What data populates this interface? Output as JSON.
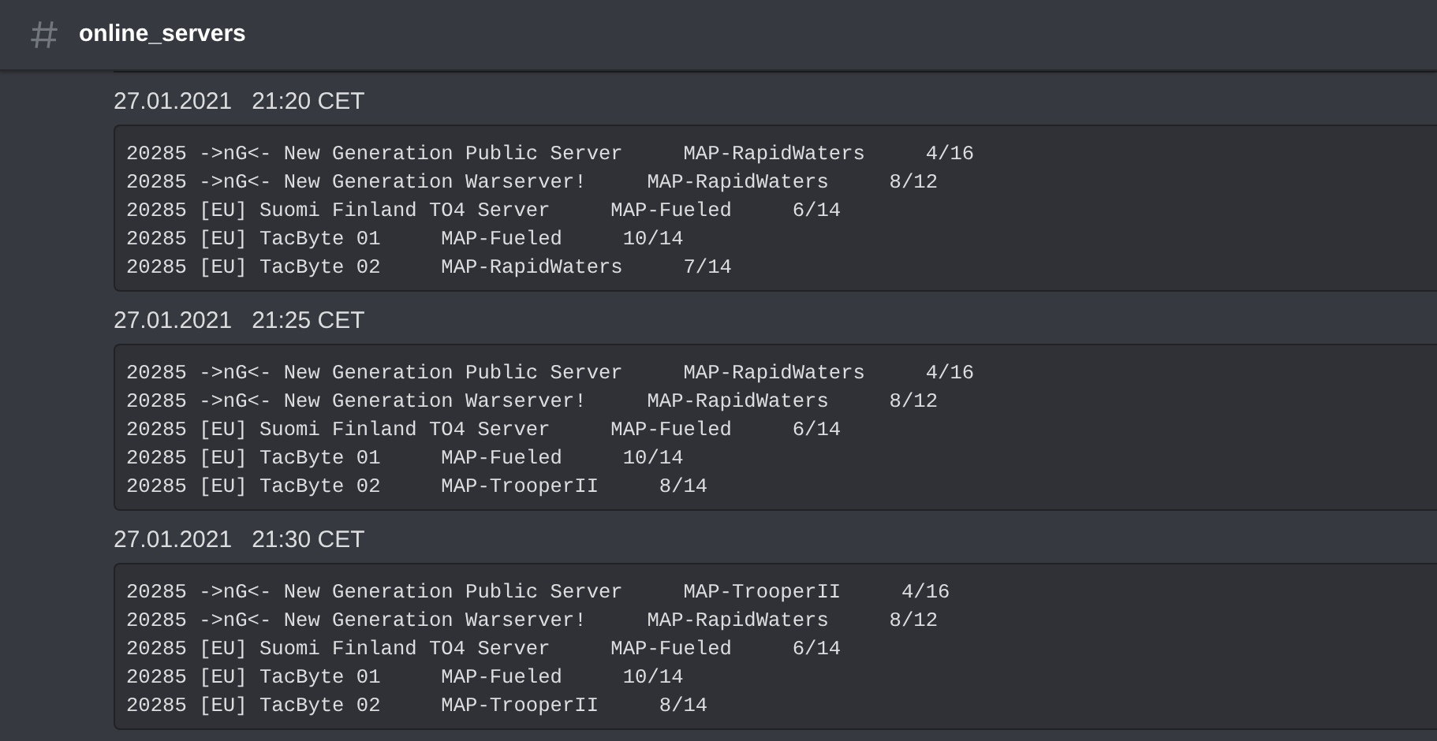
{
  "channel": {
    "name": "online_servers"
  },
  "messages": [
    {
      "timestamp": "27.01.2021   21:20 CET",
      "lines": [
        "20285 ->nG<- New Generation Public Server     MAP-RapidWaters     4/16",
        "20285 ->nG<- New Generation Warserver!     MAP-RapidWaters     8/12",
        "20285 [EU] Suomi Finland TO4 Server     MAP-Fueled     6/14",
        "20285 [EU] TacByte 01     MAP-Fueled     10/14",
        "20285 [EU] TacByte 02     MAP-RapidWaters     7/14"
      ]
    },
    {
      "timestamp": "27.01.2021   21:25 CET",
      "lines": [
        "20285 ->nG<- New Generation Public Server     MAP-RapidWaters     4/16",
        "20285 ->nG<- New Generation Warserver!     MAP-RapidWaters     8/12",
        "20285 [EU] Suomi Finland TO4 Server     MAP-Fueled     6/14",
        "20285 [EU] TacByte 01     MAP-Fueled     10/14",
        "20285 [EU] TacByte 02     MAP-TrooperII     8/14"
      ]
    },
    {
      "timestamp": "27.01.2021   21:30 CET",
      "lines": [
        "20285 ->nG<- New Generation Public Server     MAP-TrooperII     4/16",
        "20285 ->nG<- New Generation Warserver!     MAP-RapidWaters     8/12",
        "20285 [EU] Suomi Finland TO4 Server     MAP-Fueled     6/14",
        "20285 [EU] TacByte 01     MAP-Fueled     10/14",
        "20285 [EU] TacByte 02     MAP-TrooperII     8/14"
      ]
    }
  ]
}
